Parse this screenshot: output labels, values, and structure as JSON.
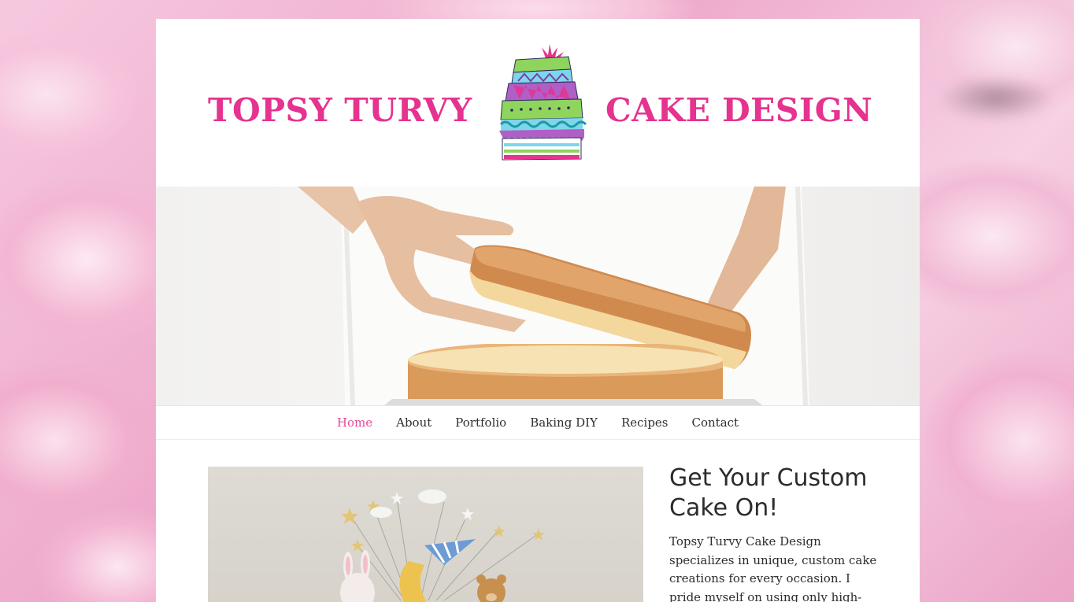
{
  "brand": {
    "left_word": "TOPSY TURVY",
    "right_word": "CAKE DESIGN",
    "logo_icon": "layered-cake-icon",
    "accent_color": "#e5338f"
  },
  "nav": {
    "items": [
      {
        "label": "Home",
        "active": true
      },
      {
        "label": "About",
        "active": false
      },
      {
        "label": "Portfolio",
        "active": false
      },
      {
        "label": "Baking DIY",
        "active": false
      },
      {
        "label": "Recipes",
        "active": false
      },
      {
        "label": "Contact",
        "active": false
      }
    ],
    "active_color": "#e5479a"
  },
  "intro": {
    "heading": "Get Your Custom Cake On!",
    "body": "Topsy Turvy Cake Design specializes in unique, custom cake creations for every occasion. I pride myself on using only high-"
  }
}
